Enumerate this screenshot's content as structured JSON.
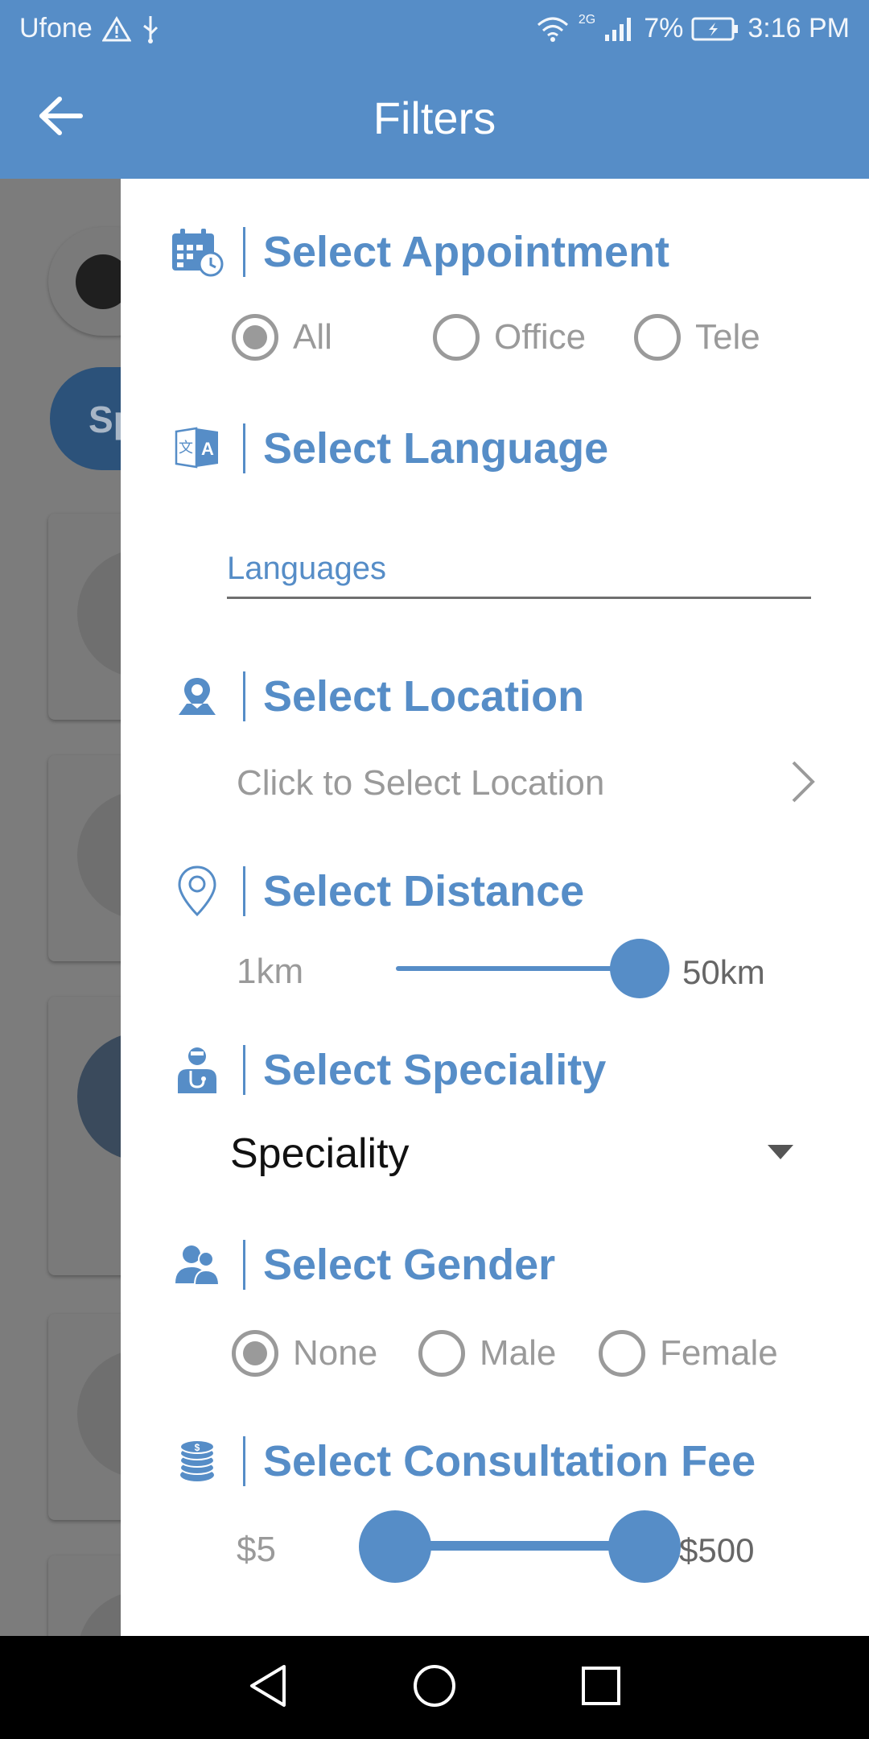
{
  "status_bar": {
    "carrier": "Ufone",
    "network": "2G",
    "battery": "7%",
    "time": "3:16 PM"
  },
  "app_bar": {
    "title": "Filters",
    "back_icon": "arrow-left-icon"
  },
  "background": {
    "chip_label": "Sp"
  },
  "filters": {
    "appointment": {
      "title": "Select Appointment",
      "icon": "calendar-clock-icon",
      "options": [
        "All",
        "Office",
        "Tele"
      ],
      "selected": "All"
    },
    "language": {
      "title": "Select Language",
      "icon": "translate-icon",
      "placeholder": "Languages"
    },
    "location": {
      "title": "Select Location",
      "icon": "map-pin-person-icon",
      "prompt": "Click to Select Location"
    },
    "distance": {
      "title": "Select Distance",
      "icon": "location-pin-icon",
      "min_label": "1km",
      "max_label": "50km",
      "value_fraction": 1.0
    },
    "speciality": {
      "title": "Select Speciality",
      "icon": "doctor-icon",
      "selected": "Speciality"
    },
    "gender": {
      "title": "Select Gender",
      "icon": "people-icon",
      "options": [
        "None",
        "Male",
        "Female"
      ],
      "selected": "None"
    },
    "fee": {
      "title": "Select Consultation Fee",
      "icon": "coins-icon",
      "min_label": "$5",
      "max_label": "$500",
      "range_fraction": [
        0.0,
        1.0
      ]
    }
  },
  "colors": {
    "primary": "#568dc7",
    "muted": "#9a9a9a"
  }
}
